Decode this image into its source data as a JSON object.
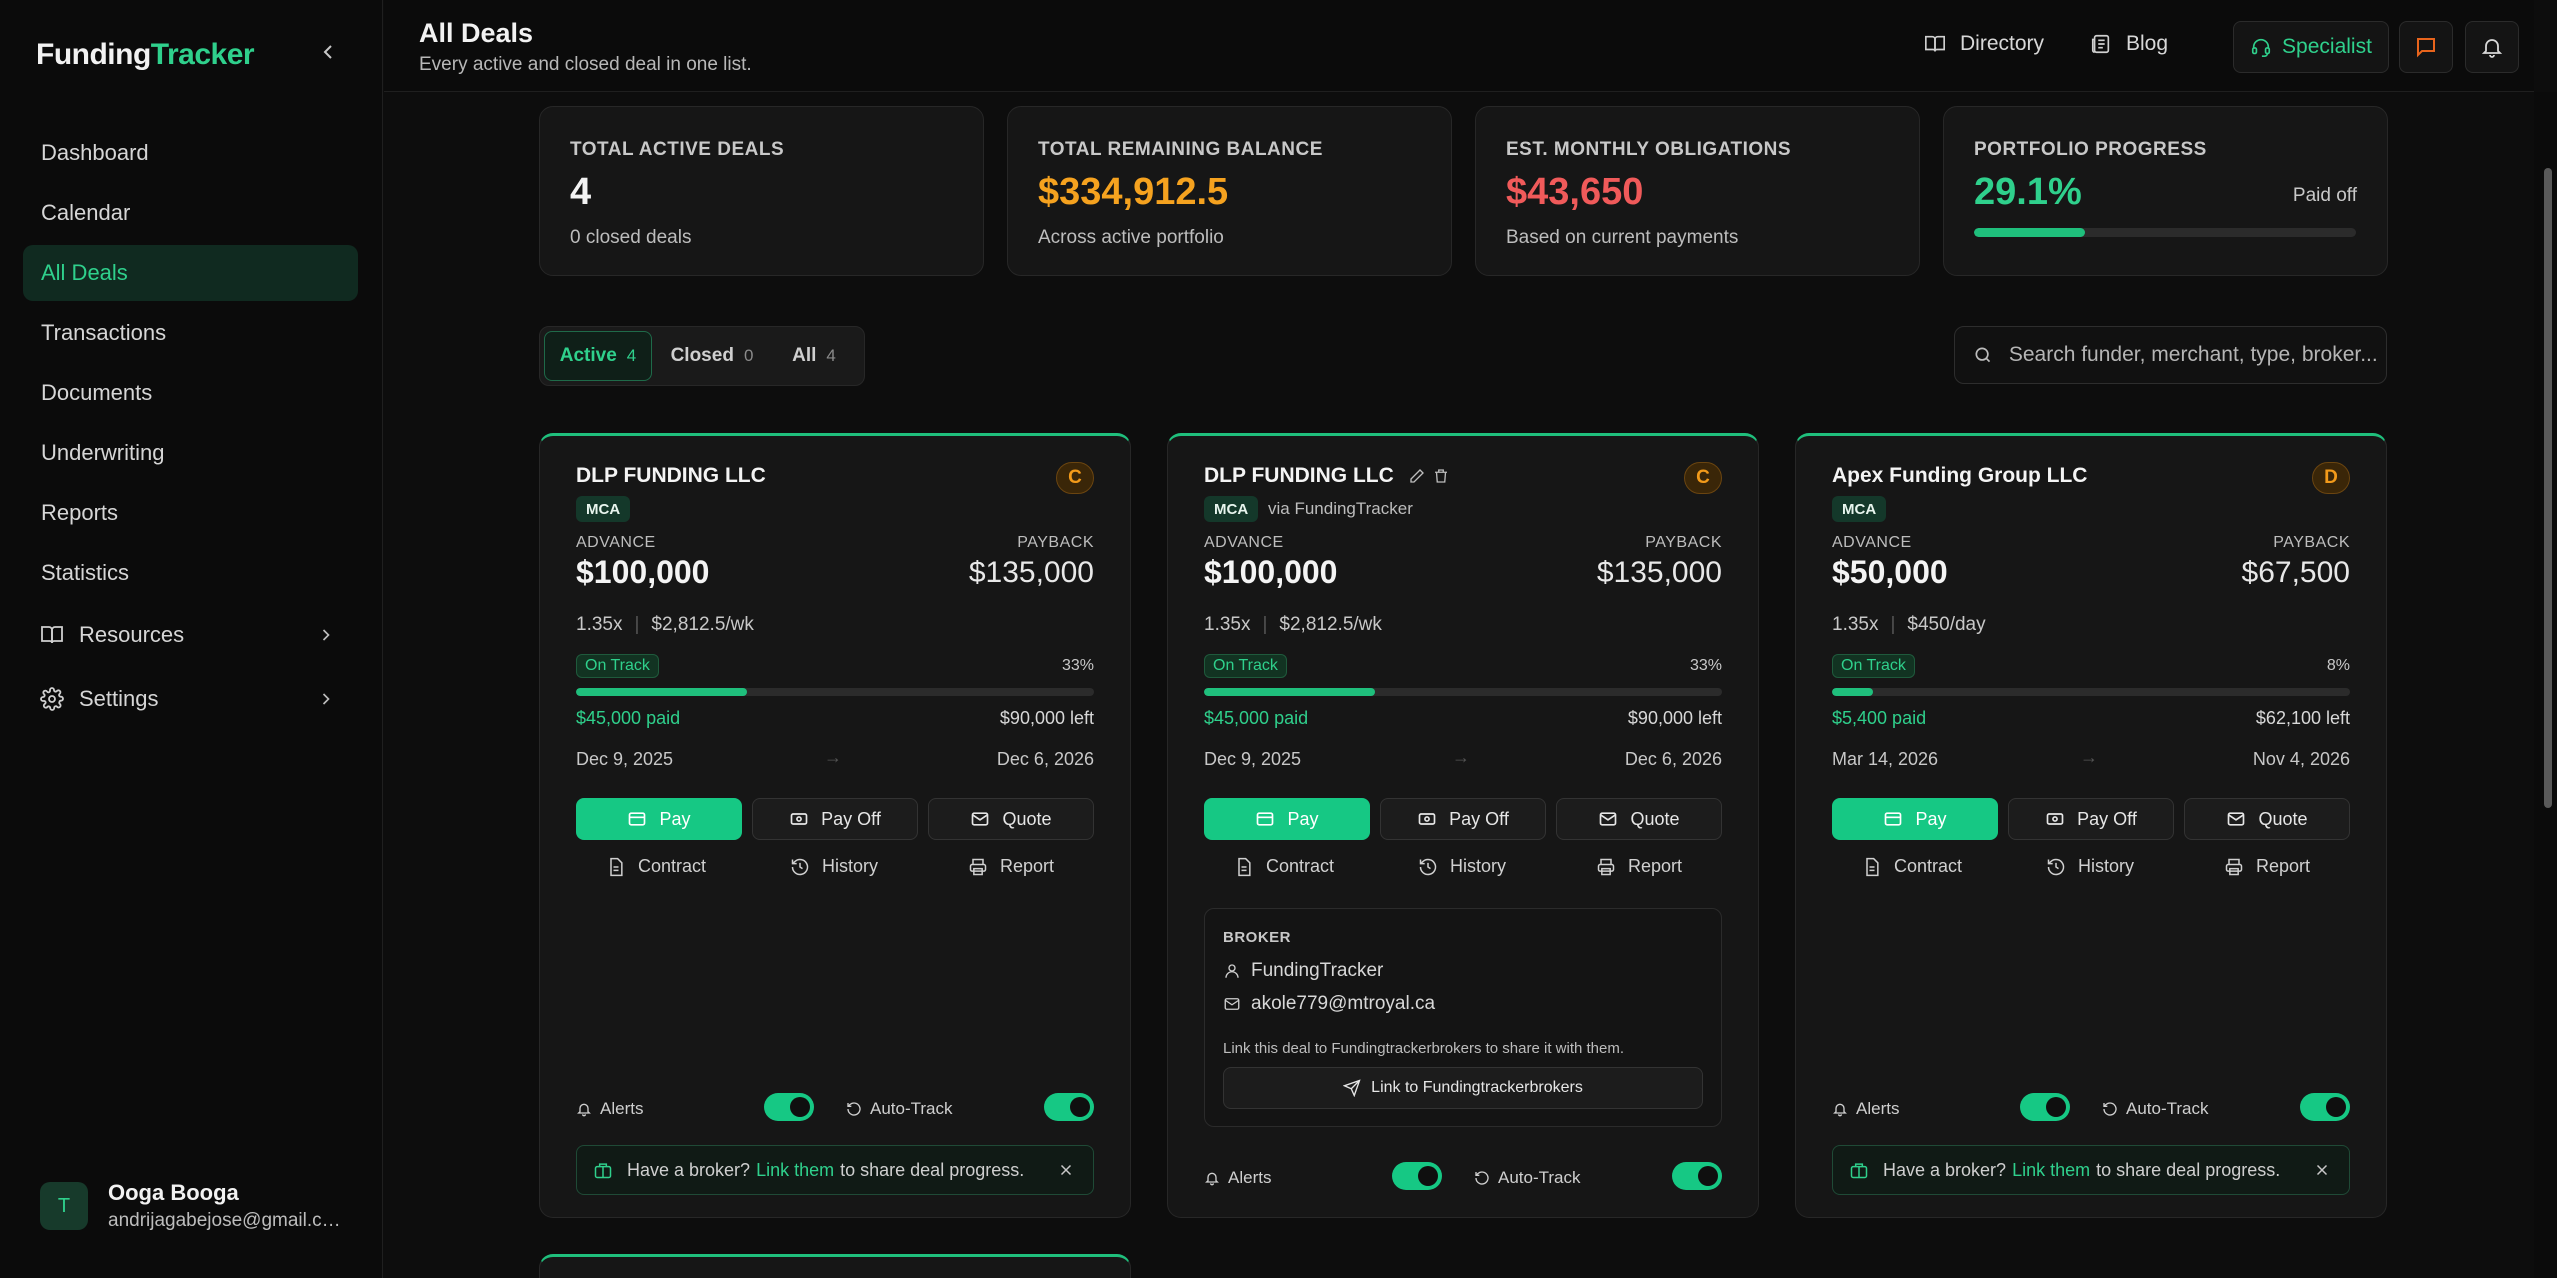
{
  "brand": {
    "part1": "Funding",
    "part2": "Tracker"
  },
  "sidebar": {
    "items": [
      {
        "label": "Dashboard"
      },
      {
        "label": "Calendar"
      },
      {
        "label": "All Deals"
      },
      {
        "label": "Transactions"
      },
      {
        "label": "Documents"
      },
      {
        "label": "Underwriting"
      },
      {
        "label": "Reports"
      },
      {
        "label": "Statistics"
      },
      {
        "label": "Resources"
      },
      {
        "label": "Settings"
      }
    ],
    "active": "All Deals"
  },
  "user": {
    "initial": "T",
    "name": "Ooga Booga",
    "email": "andrijagabejose@gmail.com"
  },
  "header": {
    "title": "All Deals",
    "subtitle": "Every active and closed deal in one list.",
    "directory": "Directory",
    "blog": "Blog",
    "specialist": "Specialist"
  },
  "stats": [
    {
      "label": "TOTAL ACTIVE DEALS",
      "value": "4",
      "sub": "0 closed deals",
      "color": "#f2f2f2"
    },
    {
      "label": "TOTAL REMAINING BALANCE",
      "value": "$334,912.5",
      "sub": "Across active portfolio",
      "color": "#f5a21f"
    },
    {
      "label": "EST. MONTHLY OBLIGATIONS",
      "value": "$43,650",
      "sub": "Based on current payments",
      "color": "#f05a5a"
    },
    {
      "label": "PORTFOLIO PROGRESS",
      "value": "29.1%",
      "right": "Paid off",
      "progress": 0.291,
      "color": "#2fd08c"
    }
  ],
  "tabs": [
    {
      "label": "Active",
      "count": "4"
    },
    {
      "label": "Closed",
      "count": "0"
    },
    {
      "label": "All",
      "count": "4"
    }
  ],
  "search": {
    "placeholder": "Search funder, merchant, type, broker..."
  },
  "labels": {
    "advance": "ADVANCE",
    "payback": "PAYBACK",
    "pay": "Pay",
    "payoff": "Pay Off",
    "quote": "Quote",
    "contract": "Contract",
    "history": "History",
    "report": "Report",
    "alerts": "Alerts",
    "autotrack": "Auto-Track",
    "broker_tip_pre": "Have a broker?",
    "broker_tip_link": "Link them",
    "broker_tip_post": "to share deal progress.",
    "broker_title": "BROKER",
    "arrow": "→"
  },
  "deals": [
    {
      "funder": "DLP FUNDING LLC",
      "grade": "C",
      "type": "MCA",
      "advance": "$100,000",
      "payback": "$135,000",
      "factor": "1.35x",
      "payment": "$2,812.5/wk",
      "status": "On Track",
      "percent": "33%",
      "progress": 0.33,
      "paid": "$45,000 paid",
      "left": "$90,000 left",
      "start": "Dec 9, 2025",
      "end": "Dec 6, 2026"
    },
    {
      "funder": "DLP FUNDING LLC",
      "grade": "C",
      "type": "MCA",
      "via": "via FundingTracker",
      "advance": "$100,000",
      "payback": "$135,000",
      "factor": "1.35x",
      "payment": "$2,812.5/wk",
      "status": "On Track",
      "percent": "33%",
      "progress": 0.33,
      "paid": "$45,000 paid",
      "left": "$90,000 left",
      "start": "Dec 9, 2025",
      "end": "Dec 6, 2026",
      "broker": {
        "name": "FundingTracker",
        "email": "akole779@mtroyal.ca",
        "note": "Link this deal to Fundingtrackerbrokers to share it with them.",
        "button": "Link to Fundingtrackerbrokers"
      }
    },
    {
      "funder": "Apex Funding Group LLC",
      "grade": "D",
      "type": "MCA",
      "advance": "$50,000",
      "payback": "$67,500",
      "factor": "1.35x",
      "payment": "$450/day",
      "status": "On Track",
      "percent": "8%",
      "progress": 0.08,
      "paid": "$5,400 paid",
      "left": "$62,100 left",
      "start": "Mar 14, 2026",
      "end": "Nov 4, 2026"
    }
  ]
}
